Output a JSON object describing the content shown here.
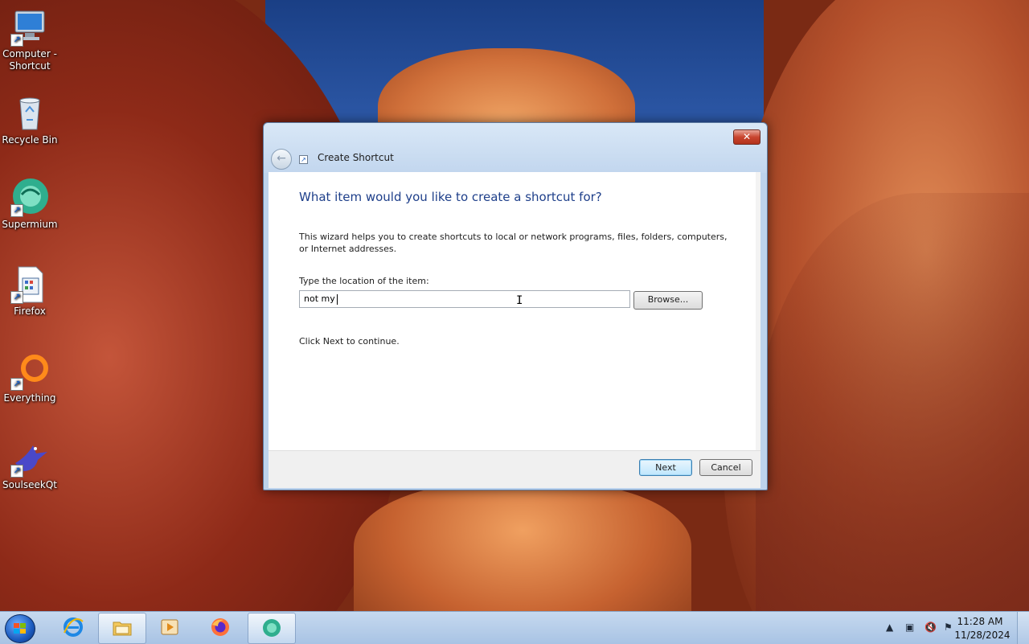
{
  "desktop": {
    "icons": [
      {
        "label": "Computer - Shortcut",
        "icon": "computer-icon",
        "shortcut": true
      },
      {
        "label": "Recycle Bin",
        "icon": "recycle-bin-icon",
        "shortcut": false
      },
      {
        "label": "Supermium",
        "icon": "supermium-icon",
        "shortcut": true
      },
      {
        "label": "Firefox",
        "icon": "document-icon",
        "shortcut": true
      },
      {
        "label": "Everything",
        "icon": "everything-icon",
        "shortcut": true
      },
      {
        "label": "SoulseekQt",
        "icon": "soulseek-bird-icon",
        "shortcut": true
      }
    ]
  },
  "dialog": {
    "title": "Create Shortcut",
    "close_symbol": "✕",
    "back_symbol": "←",
    "heading": "What item would you like to create a shortcut for?",
    "description": "This wizard helps you to create shortcuts to local or network programs, files, folders, computers, or Internet addresses.",
    "location_label": "Type the location of the item:",
    "location_value": "not my",
    "browse_label": "Browse...",
    "hint": "Click Next to continue.",
    "next_label": "Next",
    "cancel_label": "Cancel"
  },
  "taskbar": {
    "items": [
      {
        "name": "internet-explorer",
        "icon": "ie-icon",
        "active": false
      },
      {
        "name": "file-explorer",
        "icon": "folder-icon",
        "active": true
      },
      {
        "name": "media-player",
        "icon": "media-player-icon",
        "active": false
      },
      {
        "name": "firefox",
        "icon": "firefox-icon",
        "active": false
      },
      {
        "name": "supermium",
        "icon": "supermium-icon",
        "active": false
      }
    ],
    "tray": {
      "time": "11:28 AM",
      "date": "11/28/2024",
      "icons": [
        "show-hidden-icons-arrow",
        "network-icon",
        "volume-muted-icon",
        "action-center-flag-icon"
      ]
    }
  },
  "colors": {
    "heading": "#1e3f8a",
    "taskbar": "#b6cde9",
    "close_button": "#c8452f"
  }
}
